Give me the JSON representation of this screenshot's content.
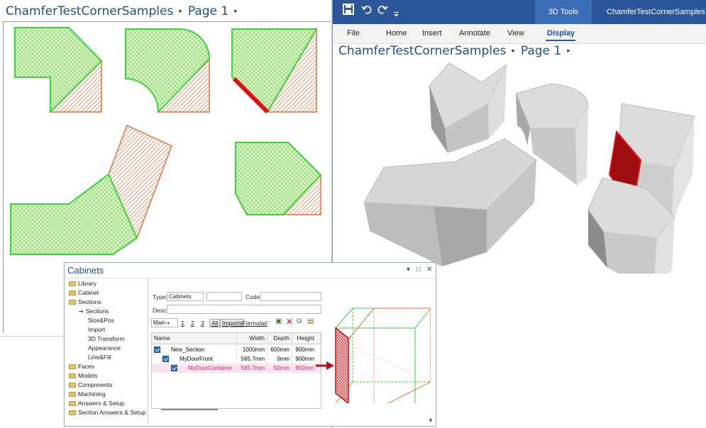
{
  "left_window": {
    "breadcrumb": [
      "ChamferTestCornerSamples",
      "Page 1"
    ],
    "separator": "▸"
  },
  "right_window": {
    "tools_tab": "3D Tools",
    "doc_title": "ChamferTestCornerSamples",
    "ribbon_tabs": [
      "File",
      "Home",
      "Insert",
      "Annotate",
      "View",
      "Display"
    ],
    "active_tab": "Display",
    "breadcrumb": [
      "ChamferTestCornerSamples",
      "Page 1"
    ]
  },
  "cabinets_panel": {
    "title": "Cabinets",
    "tree": [
      {
        "label": "Library",
        "type": "folder",
        "level": 0
      },
      {
        "label": "Cabinet",
        "type": "folder",
        "level": 0
      },
      {
        "label": "Sections",
        "type": "folder",
        "level": 0
      },
      {
        "label": "Sections",
        "type": "arrow",
        "level": 1
      },
      {
        "label": "Size&Pos",
        "type": "none",
        "level": 1
      },
      {
        "label": "Import",
        "type": "none",
        "level": 1
      },
      {
        "label": "3D Transform",
        "type": "none",
        "level": 1
      },
      {
        "label": "Appearance",
        "type": "none",
        "level": 1
      },
      {
        "label": "Line&Fill",
        "type": "none",
        "level": 1
      },
      {
        "label": "Faces",
        "type": "folder",
        "level": 0
      },
      {
        "label": "Models",
        "type": "folder",
        "level": 0
      },
      {
        "label": "Components",
        "type": "folder",
        "level": 0
      },
      {
        "label": "Machining",
        "type": "folder",
        "level": 0
      },
      {
        "label": "Answers & Setup",
        "type": "folder",
        "level": 0
      },
      {
        "label": "Section Answers & Setup",
        "type": "folder",
        "level": 0
      }
    ],
    "form": {
      "type_label": "Type:",
      "type_value": "Cabinets",
      "code_label": "Code:",
      "desc_label": "Desc:",
      "main_select": "Main",
      "toolbar_buttons": [
        "1",
        "2",
        "3",
        "All",
        "Imports",
        "Formulas"
      ]
    },
    "grid": {
      "columns": [
        "Name",
        "Width",
        "Depth",
        "Height"
      ],
      "rows": [
        {
          "name": "New_Section",
          "width": "1000mm",
          "depth": "600mm",
          "height": "900mm",
          "level": 0,
          "highlight": false
        },
        {
          "name": "MyDoorFront",
          "width": "565.7mm",
          "depth": "0mm",
          "height": "900mm",
          "level": 1,
          "highlight": false
        },
        {
          "name": "MyDoorContainer",
          "width": "565.7mm",
          "depth": "50mm",
          "height": "902mm",
          "level": 2,
          "highlight": true
        }
      ]
    },
    "colors": {
      "highlight_text": "#e0206a",
      "highlight_bg": "#fbe3ef"
    }
  },
  "icons": [
    "save-icon",
    "undo-icon",
    "redo-icon",
    "quick-access-dropdown-icon",
    "folder-icon",
    "swap-icon",
    "new-icon",
    "delete-icon",
    "copy-icon",
    "paste-icon"
  ]
}
